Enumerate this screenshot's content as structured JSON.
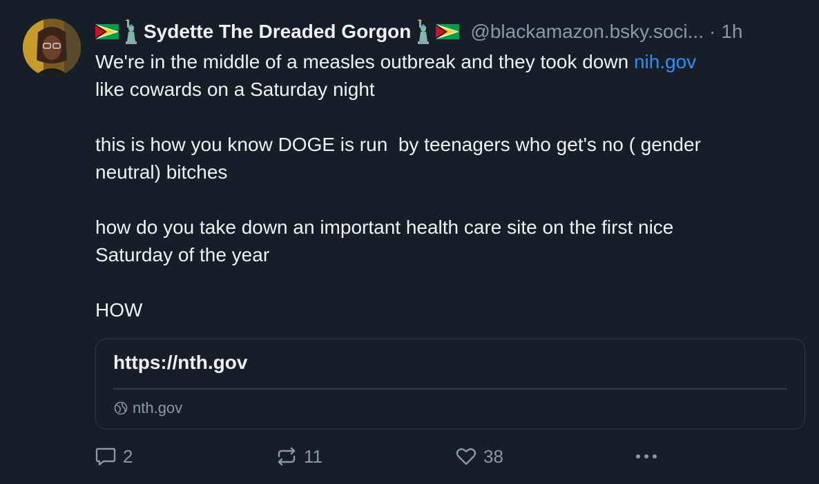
{
  "post": {
    "display_name": "Sydette The Dreaded Gorgon",
    "handle": "@blackamazon.bsky.soci...",
    "separator": "·",
    "time": "1h",
    "text_before_link": "We're in the middle of a measles outbreak and they took down ",
    "link_text": "nih.gov",
    "text_after_link": "\nlike cowards on a Saturday night\n\nthis is how you know DOGE is run  by teenagers who get's no ( gender\nneutral) bitches\n\nhow do you take down an important health care site on the first nice\nSaturday of the year\n\nHOW"
  },
  "link_card": {
    "title": "https://nth.gov",
    "domain": "nth.gov"
  },
  "actions": {
    "reply_count": "2",
    "repost_count": "11",
    "like_count": "38"
  },
  "icons": {
    "name_prefix": [
      "guyana-flag-icon",
      "statue-of-liberty-icon"
    ],
    "name_suffix": [
      "statue-of-liberty-icon",
      "guyana-flag-icon"
    ],
    "card": "globe-icon",
    "actions": [
      "reply-icon",
      "repost-icon",
      "like-icon",
      "more-icon"
    ]
  },
  "colors": {
    "background": "#161e27",
    "text": "#f1f3f5",
    "muted": "#8b98a8",
    "link": "#2f8df6",
    "border": "#2e3a48"
  }
}
